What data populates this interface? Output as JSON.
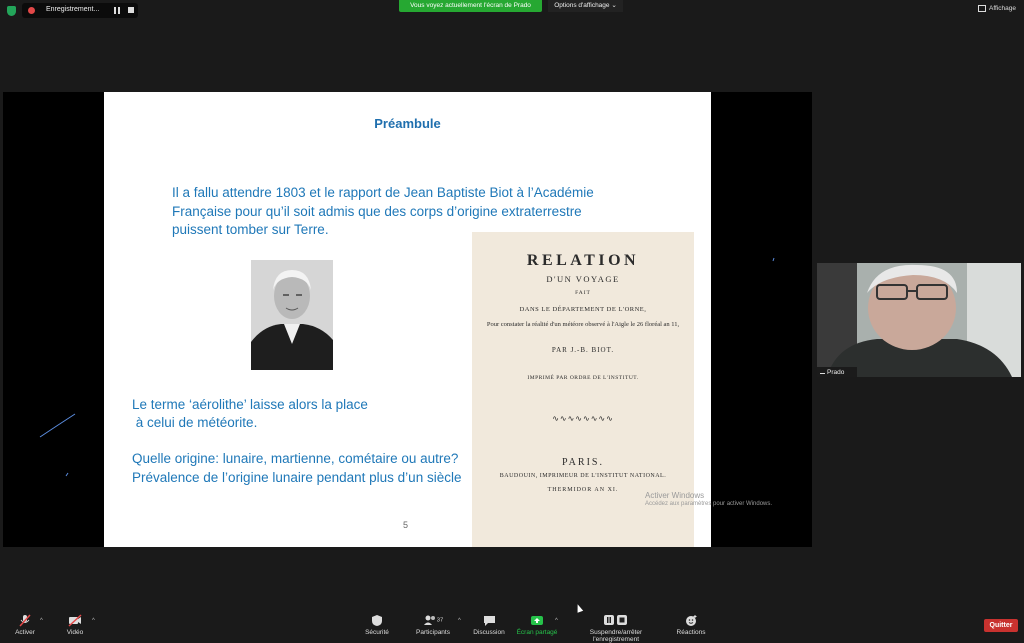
{
  "topbar": {
    "recording_label": "Enregistrement...",
    "share_banner": "Vous voyez actuellement l'écran de Prado",
    "view_options": "Options d'affichage",
    "view_button": "Affichage"
  },
  "slide": {
    "title": "Préambule",
    "para1": "Il a fallu attendre 1803 et le rapport de Jean Baptiste Biot à l’Académie Française pour qu’il soit admis que des corps d’origine extraterrestre puissent tomber sur Terre.",
    "para2_line1": "Le terme ‘aérolithe’ laisse alors la place",
    "para2_line2": " à celui de météorite.",
    "para3_line1": "Quelle origine: lunaire, martienne, cométaire ou autre?",
    "para3_line2": "Prévalence de l’origine lunaire pendant plus d’un siècle",
    "page_number": "5",
    "book": {
      "title": "RELATION",
      "subtitle": "D'UN VOYAGE",
      "fait": "FAIT",
      "dept": "DANS LE DÉPARTEMENT DE L'ORNE,",
      "purpose": "Pour constater la réalité d'un météore observé à l'Aigle le 26 floréal an 11,",
      "author": "PAR J.-B. BIOT.",
      "imprime": "IMPRIMÉ PAR ORDRE DE L'INSTITUT.",
      "ornament": "∿∿∿∿∿∿∿∿",
      "city": "PARIS.",
      "printer": "BAUDOUIN, IMPRIMEUR DE L'INSTITUT NATIONAL.",
      "date": "THERMIDOR AN XI."
    }
  },
  "watermark": {
    "line1": "Activer Windows",
    "line2": "Accédez aux paramètres pour activer Windows."
  },
  "video": {
    "name": "Prado"
  },
  "toolbar": {
    "mute": "Activer",
    "video": "Vidéo",
    "security": "Sécurité",
    "participants": "Participants",
    "participants_count": "37",
    "chat": "Discussion",
    "share": "Écran partagé",
    "record": "Suspendre/arrêter l'enregistrement",
    "reactions": "Réactions",
    "quit": "Quitter"
  }
}
